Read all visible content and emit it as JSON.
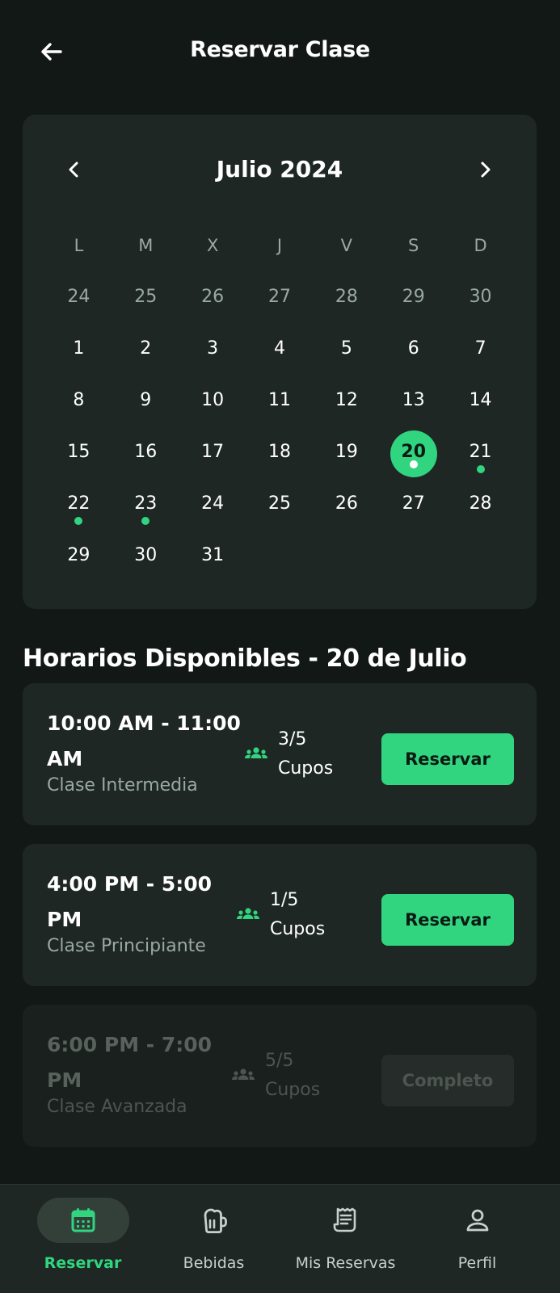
{
  "header": {
    "title": "Reservar Clase",
    "back_icon": "arrow-left-icon"
  },
  "calendar": {
    "month_label": "Julio 2024",
    "prev_icon": "chevron-left-icon",
    "next_icon": "chevron-right-icon",
    "weekdays": [
      "L",
      "M",
      "X",
      "J",
      "V",
      "S",
      "D"
    ],
    "weeks": [
      [
        {
          "d": "24",
          "other": true
        },
        {
          "d": "25",
          "other": true
        },
        {
          "d": "26",
          "other": true
        },
        {
          "d": "27",
          "other": true
        },
        {
          "d": "28",
          "other": true
        },
        {
          "d": "29",
          "other": true
        },
        {
          "d": "30",
          "other": true
        }
      ],
      [
        {
          "d": "1"
        },
        {
          "d": "2"
        },
        {
          "d": "3"
        },
        {
          "d": "4"
        },
        {
          "d": "5"
        },
        {
          "d": "6"
        },
        {
          "d": "7"
        }
      ],
      [
        {
          "d": "8"
        },
        {
          "d": "9"
        },
        {
          "d": "10"
        },
        {
          "d": "11"
        },
        {
          "d": "12"
        },
        {
          "d": "13"
        },
        {
          "d": "14"
        }
      ],
      [
        {
          "d": "15"
        },
        {
          "d": "16"
        },
        {
          "d": "17"
        },
        {
          "d": "18"
        },
        {
          "d": "19"
        },
        {
          "d": "20",
          "selected": true,
          "dot": true
        },
        {
          "d": "21",
          "dot": true
        }
      ],
      [
        {
          "d": "22",
          "dot": true
        },
        {
          "d": "23",
          "dot": true
        },
        {
          "d": "24"
        },
        {
          "d": "25"
        },
        {
          "d": "26"
        },
        {
          "d": "27"
        },
        {
          "d": "28"
        }
      ],
      [
        {
          "d": "29"
        },
        {
          "d": "30"
        },
        {
          "d": "31"
        }
      ]
    ]
  },
  "section_title": "Horarios Disponibles - 20 de Julio",
  "slots": [
    {
      "time": "10:00 AM - 11:00 AM",
      "level": "Clase Intermedia",
      "capacity": "3/5 Cupos",
      "button": "Reservar",
      "disabled": false
    },
    {
      "time": "4:00 PM - 5:00 PM",
      "level": "Clase Principiante",
      "capacity": "1/5 Cupos",
      "button": "Reservar",
      "disabled": false
    },
    {
      "time": "6:00 PM - 7:00 PM",
      "level": "Clase Avanzada",
      "capacity": "5/5 Cupos",
      "button": "Completo",
      "disabled": true
    }
  ],
  "bottom_nav": [
    {
      "label": "Reservar",
      "icon": "calendar-icon",
      "active": true
    },
    {
      "label": "Bebidas",
      "icon": "beer-mug-icon",
      "active": false
    },
    {
      "label": "Mis Reservas",
      "icon": "receipt-icon",
      "active": false
    },
    {
      "label": "Perfil",
      "icon": "person-icon",
      "active": false
    }
  ],
  "colors": {
    "background": "#121816",
    "card": "#1e2723",
    "accent": "#31d47f",
    "muted": "#9aa8a2"
  }
}
